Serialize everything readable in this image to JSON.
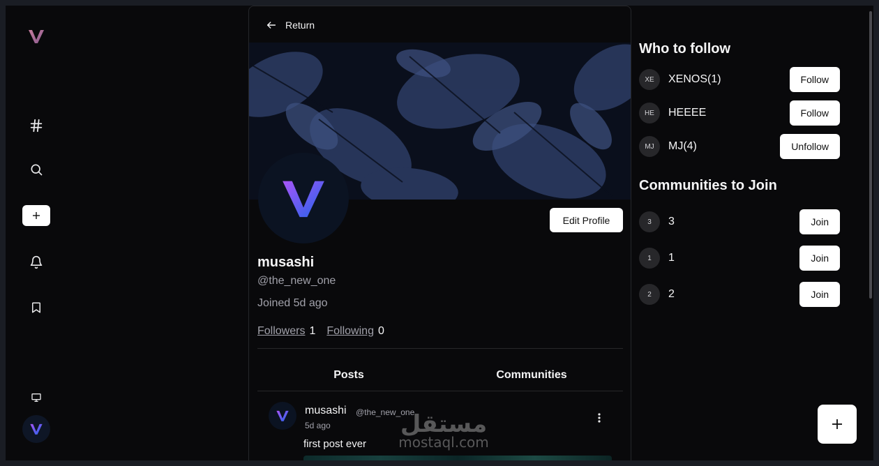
{
  "nav": {
    "return_label": "Return",
    "icons": [
      "logo-icon",
      "hash-icon",
      "search-icon",
      "plus-icon",
      "bell-icon",
      "bookmark-icon",
      "monitor-icon",
      "avatar"
    ]
  },
  "profile": {
    "display_name": "musashi",
    "handle": "@the_new_one",
    "joined": "Joined 5d ago",
    "edit_label": "Edit Profile",
    "followers_label": "Followers",
    "followers_count": "1",
    "following_label": "Following",
    "following_count": "0"
  },
  "tabs": [
    "Posts",
    "Communities"
  ],
  "post": {
    "author": "musashi",
    "handle": "@the_new_one",
    "time": "5d ago",
    "text": "first post ever"
  },
  "who_to_follow": {
    "title": "Who to follow",
    "items": [
      {
        "initials": "XE",
        "name": "XENOS(1)",
        "action": "Follow"
      },
      {
        "initials": "HE",
        "name": "HEEEE",
        "action": "Follow"
      },
      {
        "initials": "MJ",
        "name": "MJ(4)",
        "action": "Unfollow"
      }
    ]
  },
  "communities": {
    "title": "Communities to Join",
    "items": [
      {
        "initials": "3",
        "name": "3",
        "action": "Join"
      },
      {
        "initials": "1",
        "name": "1",
        "action": "Join"
      },
      {
        "initials": "2",
        "name": "2",
        "action": "Join"
      }
    ]
  },
  "watermark": {
    "arabic": "مستقل",
    "latin": "mostaql.com"
  },
  "colors": {
    "background": "#09090b",
    "accent_purple": "#7c3aed",
    "accent_blue": "#2563eb",
    "button": "#ffffff"
  }
}
